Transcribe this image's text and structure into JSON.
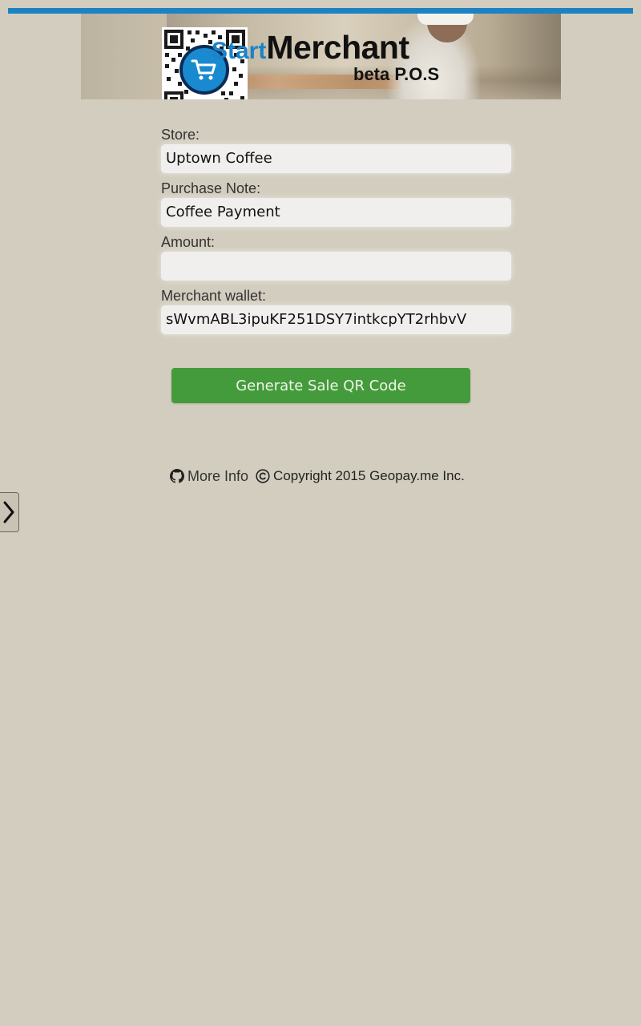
{
  "colors": {
    "background": "#d3cdbf",
    "top_bar": "#1c82c4",
    "button": "#449b3b",
    "brand_blue": "#1a82c8",
    "cart_circle": "#1a8ad0"
  },
  "header": {
    "brand_start": "Start",
    "brand_merchant": "Merchant",
    "brand_sub": "beta P.O.S",
    "logo_icon": "qr-code-cart-icon"
  },
  "form": {
    "store_label": "Store:",
    "store_value": "Uptown Coffee",
    "note_label": "Purchase Note:",
    "note_value": "Coffee Payment",
    "amount_label": "Amount:",
    "amount_value": "",
    "wallet_label": "Merchant wallet:",
    "wallet_value": "sWvmABL3ipuKF251DSY7intkcpYT2rhbvV"
  },
  "actions": {
    "generate_label": "Generate Sale QR Code"
  },
  "footer": {
    "more_info_label": "More Info",
    "more_info_icon": "github-icon",
    "copyright_icon": "copyright-icon",
    "copyright_text": "Copyright 2015 Geopay.me Inc."
  },
  "side_tab": {
    "icon": "chevron-right-icon"
  }
}
